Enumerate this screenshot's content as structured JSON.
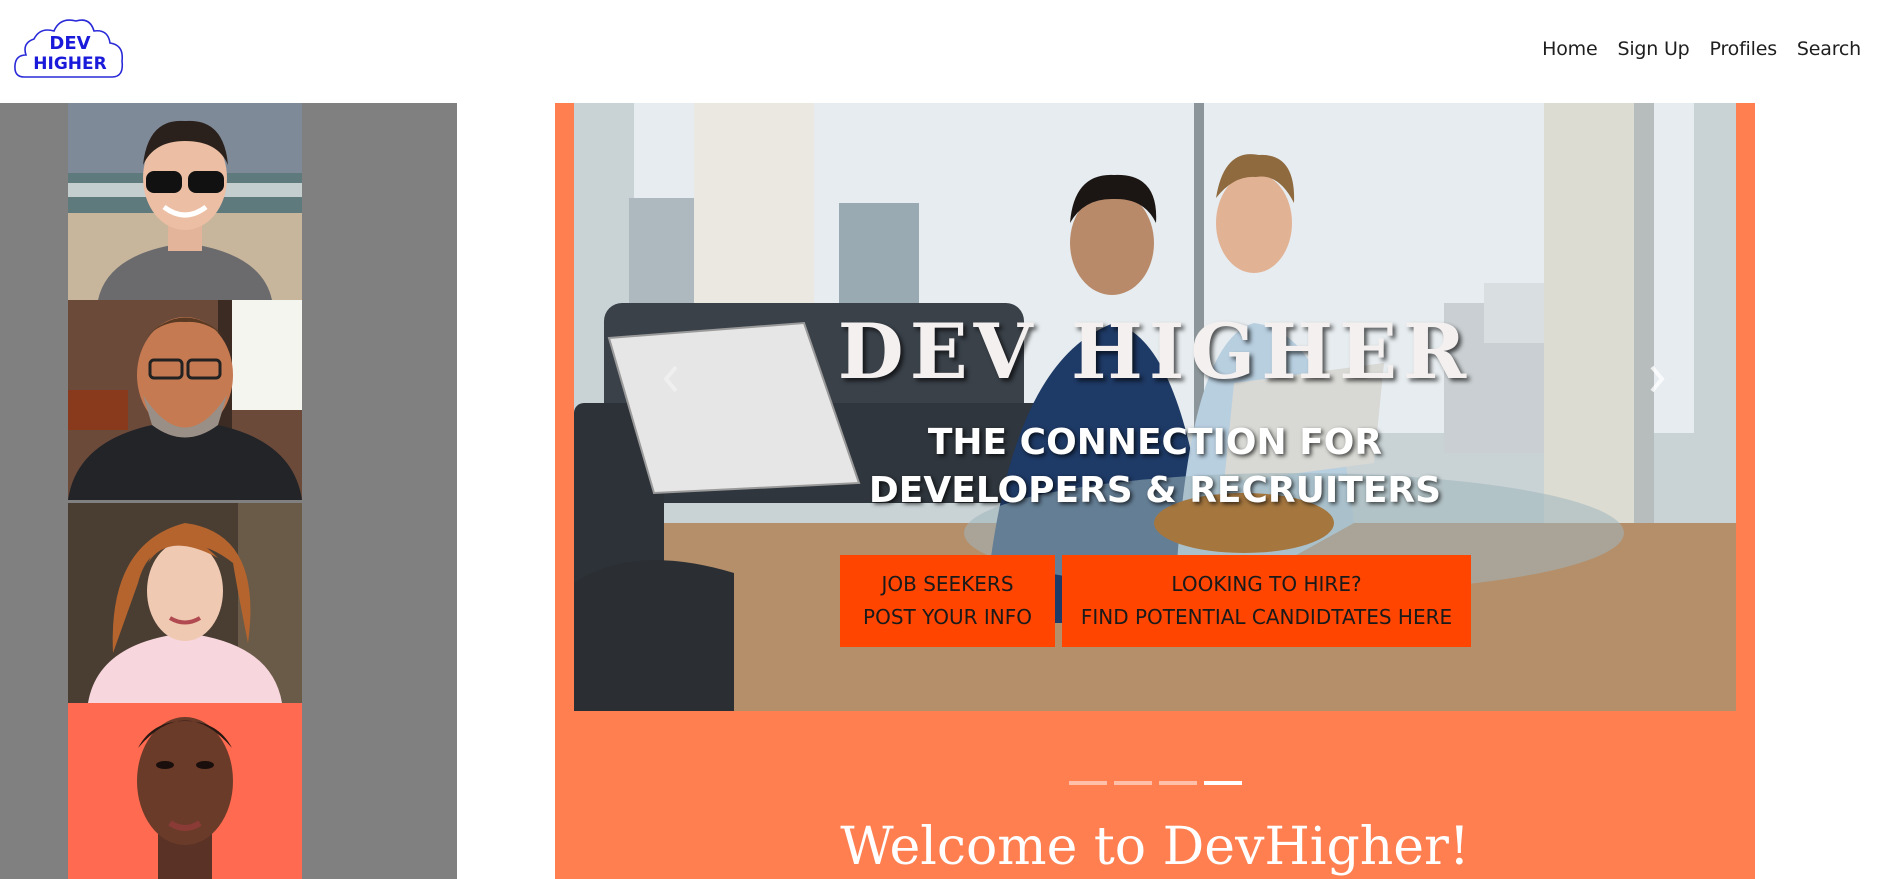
{
  "brand": {
    "logo_line1": "DEV",
    "logo_line2": "HIGHER",
    "logo_color": "#1a1adb"
  },
  "nav": {
    "items": [
      {
        "label": "Home"
      },
      {
        "label": "Sign Up"
      },
      {
        "label": "Profiles"
      },
      {
        "label": "Search"
      }
    ]
  },
  "hero": {
    "title": "DEV HIGHER",
    "subtitle_line1": "THE CONNECTION FOR",
    "subtitle_line2": "DEVELOPERS & RECRUITERS",
    "cta_jobseekers": {
      "line1": "JOB SEEKERS",
      "line2": "POST YOUR INFO"
    },
    "cta_hire": {
      "line1": "LOOKING TO HIRE?",
      "line2": "FIND POTENTIAL CANDIDTATES HERE"
    },
    "slides_count": 4,
    "active_slide": 4
  },
  "welcome": {
    "text": "Welcome to DevHigher!"
  },
  "colors": {
    "sidebar_bg": "#808080",
    "main_bg": "#ff7f50",
    "cta_bg": "#ff4500",
    "profile4_bg": "#ff6a50"
  },
  "icons": {
    "next": "chevron-right-icon",
    "prev": "chevron-left-icon"
  }
}
